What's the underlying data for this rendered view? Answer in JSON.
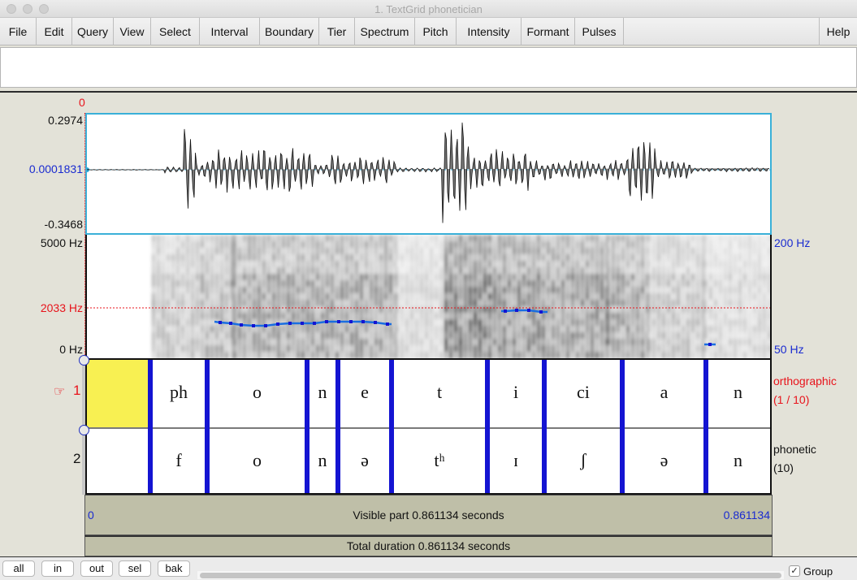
{
  "window": {
    "title": "1. TextGrid phonetician"
  },
  "menu": {
    "items": [
      "File",
      "Edit",
      "Query",
      "View",
      "Select",
      "Interval",
      "Boundary",
      "Tier",
      "Spectrum",
      "Pitch",
      "Intensity",
      "Formant",
      "Pulses"
    ],
    "help": "Help"
  },
  "text_field": {
    "value": ""
  },
  "cursor": {
    "time_label": "0"
  },
  "waveform": {
    "max_label": "0.2974",
    "mid_label": "0.0001831",
    "min_label": "-0.3468"
  },
  "spectrogram": {
    "top_label": "5000 Hz",
    "cursor_freq_label": "2033 Hz",
    "bottom_label": "0 Hz",
    "pitch_top_label": "200 Hz",
    "pitch_bottom_label": "50 Hz",
    "pitch_color": "#1a6ee0"
  },
  "tiers": [
    {
      "number": "1",
      "pointer_icon": "☞",
      "name": "orthographic",
      "count": "(1 / 10)",
      "selected": true,
      "intervals": [
        "",
        "ph",
        "o",
        "n",
        "e",
        "t",
        "i",
        "ci",
        "a",
        "n"
      ]
    },
    {
      "number": "2",
      "name": "phonetic",
      "count": "(10)",
      "selected": false,
      "intervals": [
        "",
        "f",
        "o",
        "n",
        "ə",
        "tʰ",
        "ɪ",
        "ʃ",
        "ə",
        "n"
      ]
    }
  ],
  "time_bar": {
    "start": "0",
    "end": "0.861134",
    "visible_part": "Visible part 0.861134 seconds",
    "total_duration": "Total duration 0.861134 seconds"
  },
  "bottom": {
    "buttons": [
      "all",
      "in",
      "out",
      "sel",
      "bak"
    ],
    "group_checked": true,
    "group_label": "Group",
    "check_glyph": "✓"
  },
  "colors": {
    "boundary": "#1414d2",
    "selection": "#f8f052",
    "cursor": "#e8131b",
    "axis_blue": "#1a2bd0"
  }
}
